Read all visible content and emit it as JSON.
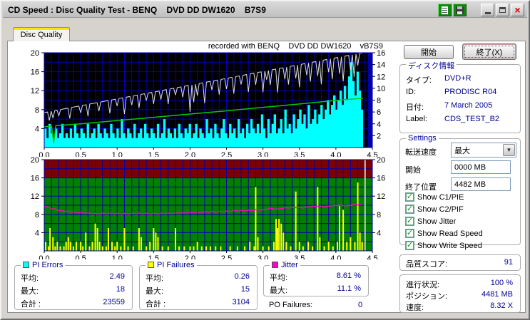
{
  "window": {
    "title": "CD Speed : Disc Quality Test - BENQ    DVD DD DW1620    B7S9"
  },
  "tab": {
    "label": "Disc Quality"
  },
  "chart_caption": "recorded with BENQ    DVD DD DW1620    vB7S9",
  "buttons": {
    "start": "開始",
    "exit": "終了(X)"
  },
  "disc_info": {
    "title": "ディスク情報",
    "rows": [
      {
        "label": "タイプ:",
        "value": "DVD+R"
      },
      {
        "label": "ID:",
        "value": "PRODISC R04"
      },
      {
        "label": "日付:",
        "value": "7 March 2005"
      },
      {
        "label": "Label:",
        "value": "CDS_TEST_B2"
      }
    ]
  },
  "settings": {
    "title": "Settings",
    "transfer_label": "転送速度",
    "transfer_value": "最大",
    "start_label": "開始",
    "start_value": "0000 MB",
    "end_label": "終了位置",
    "end_value": "4482 MB",
    "checkboxes": [
      {
        "label": "Show C1/PIE",
        "checked": true
      },
      {
        "label": "Show C2/PIF",
        "checked": true
      },
      {
        "label": "Show Jitter",
        "checked": true
      },
      {
        "label": "Show Read Speed",
        "checked": true
      },
      {
        "label": "Show Write Speed",
        "checked": true
      }
    ]
  },
  "quality": {
    "label": "品質スコア:",
    "value": "91"
  },
  "progress": {
    "rows": [
      {
        "label": "進行状況:",
        "value": "100 %"
      },
      {
        "label": "ポジション:",
        "value": "4481 MB"
      },
      {
        "label": "速度:",
        "value": "8.32 X"
      }
    ]
  },
  "stats": {
    "pi_errors": {
      "title": "PI Errors",
      "legend_color": "#00ffff",
      "rows": [
        {
          "label": "平均:",
          "value": "2.49"
        },
        {
          "label": "最大:",
          "value": "18"
        },
        {
          "label": "合計 :",
          "value": "23559"
        }
      ]
    },
    "pi_failures": {
      "title": "PI Failures",
      "legend_color": "#ffff00",
      "rows": [
        {
          "label": "平均:",
          "value": "0.26"
        },
        {
          "label": "最大:",
          "value": "15"
        },
        {
          "label": "合計 :",
          "value": "3104"
        }
      ]
    },
    "jitter": {
      "title": "Jitter",
      "legend_color": "#ff00cc",
      "rows": [
        {
          "label": "平均:",
          "value": "8.61 %"
        },
        {
          "label": "最大:",
          "value": "11.1 %"
        }
      ]
    },
    "po_failures": {
      "label": "PO Failures:",
      "value": "0"
    }
  },
  "chart_data": [
    {
      "type": "area",
      "title": "PI Errors with Read/Write Speed",
      "x_range": [
        0,
        4.5
      ],
      "x_ticks": [
        "0.0",
        "0.5",
        "1.0",
        "1.5",
        "2.0",
        "2.5",
        "3.0",
        "3.5",
        "4.0",
        "4.5"
      ],
      "left_axis": {
        "range": [
          0,
          20
        ],
        "ticks": [
          20,
          16,
          12,
          8,
          4
        ],
        "minor_step": 2
      },
      "right_axis": {
        "range": [
          0,
          16
        ],
        "ticks": [
          16,
          14,
          12,
          10,
          8,
          6,
          4,
          2
        ]
      },
      "bg": "#000000",
      "grid": "#0000b0",
      "data_end_x": 4.37,
      "pi_errors": {
        "name": "PI Errors",
        "color": "#00ffff",
        "axis": "left",
        "values": [
          4,
          2,
          5,
          3,
          2,
          4,
          2,
          3,
          5,
          2,
          3,
          2,
          4,
          2,
          5,
          3,
          2,
          4,
          3,
          2,
          5,
          2,
          3,
          4,
          2,
          5,
          3,
          2,
          4,
          3,
          2,
          5,
          3,
          2,
          4,
          2,
          6,
          3,
          2,
          4,
          3,
          2,
          5,
          2,
          3,
          4,
          2,
          5,
          3,
          2,
          4,
          3,
          2,
          5,
          2,
          3,
          6,
          2,
          4,
          3,
          2,
          4,
          2,
          5,
          3,
          2,
          4,
          3,
          5,
          2,
          3,
          5,
          2,
          4,
          3,
          2,
          6,
          3,
          4,
          2,
          5,
          3,
          2,
          4,
          6,
          3,
          2,
          5,
          3,
          4,
          2,
          6,
          3,
          4,
          2,
          5,
          3,
          6,
          4,
          3,
          5,
          3,
          7,
          4,
          2,
          6,
          3,
          5,
          7,
          3,
          4,
          6,
          3,
          8,
          4,
          5,
          3,
          7,
          4,
          6,
          8,
          5,
          7,
          4,
          9,
          5,
          6,
          8,
          5,
          7,
          9,
          6,
          8,
          10,
          7,
          9,
          11,
          8,
          10,
          12,
          9,
          13,
          10,
          15,
          18,
          14,
          11,
          16,
          12,
          8
        ]
      },
      "write_speed": {
        "name": "Write Speed",
        "color": "#dcdcdc",
        "axis": "right",
        "start": 5.9,
        "end": 16.0,
        "dips": [
          [
            0.07,
            1.5
          ],
          [
            0.12,
            1.2
          ],
          [
            0.2,
            1.0
          ],
          [
            0.35,
            1.8
          ],
          [
            0.5,
            1.2
          ],
          [
            0.6,
            2.0
          ],
          [
            0.75,
            1.5
          ],
          [
            0.9,
            2.2
          ],
          [
            1.0,
            1.2
          ],
          [
            1.1,
            2.8
          ],
          [
            1.2,
            1.5
          ],
          [
            1.3,
            2.2
          ],
          [
            1.4,
            1.2
          ],
          [
            1.5,
            2.0
          ],
          [
            1.6,
            1.5
          ],
          [
            1.7,
            2.5
          ],
          [
            1.8,
            1.2
          ],
          [
            1.9,
            1.8
          ],
          [
            2.0,
            4.5
          ],
          [
            2.05,
            3.0
          ],
          [
            2.1,
            2.0
          ],
          [
            2.2,
            3.5
          ],
          [
            2.3,
            1.5
          ],
          [
            2.4,
            2.5
          ],
          [
            2.5,
            1.8
          ],
          [
            2.6,
            2.8
          ],
          [
            2.7,
            1.5
          ],
          [
            2.8,
            3.0
          ],
          [
            2.9,
            2.0
          ],
          [
            3.0,
            3.5
          ],
          [
            3.05,
            1.5
          ],
          [
            3.1,
            2.5
          ],
          [
            3.2,
            4.0
          ],
          [
            3.3,
            2.0
          ],
          [
            3.35,
            3.0
          ],
          [
            3.45,
            2.2
          ],
          [
            3.5,
            3.8
          ],
          [
            3.6,
            2.0
          ],
          [
            3.65,
            3.2
          ],
          [
            3.75,
            2.5
          ],
          [
            3.8,
            4.0
          ],
          [
            3.9,
            2.2
          ],
          [
            3.95,
            3.5
          ],
          [
            4.05,
            2.8
          ],
          [
            4.1,
            4.2
          ],
          [
            4.2,
            2.5
          ],
          [
            4.25,
            3.8
          ],
          [
            4.3,
            2.0
          ]
        ]
      },
      "read_speed": {
        "name": "Read Speed",
        "color": "#00cc00",
        "axis": "right",
        "points": [
          [
            0,
            3.5
          ],
          [
            0.1,
            3.62
          ],
          [
            0.13,
            0.8
          ],
          [
            0.16,
            3.7
          ],
          [
            0.5,
            4.0
          ],
          [
            1.0,
            4.55
          ],
          [
            1.5,
            5.1
          ],
          [
            2.0,
            5.65
          ],
          [
            2.5,
            6.2
          ],
          [
            3.0,
            6.78
          ],
          [
            3.5,
            7.35
          ],
          [
            4.0,
            7.95
          ],
          [
            4.37,
            8.32
          ]
        ]
      }
    },
    {
      "type": "bars",
      "title": "PI Failures with Jitter",
      "x_range": [
        0,
        4.5
      ],
      "x_ticks": [
        "0.0",
        "0.5",
        "1.0",
        "1.5",
        "2.0",
        "2.5",
        "3.0",
        "3.5",
        "4.0",
        "4.5"
      ],
      "left_axis": {
        "range": [
          0,
          20
        ],
        "ticks": [
          20,
          16,
          12,
          8,
          4
        ],
        "minor_step": 2
      },
      "right_axis": {
        "range": [
          0,
          20
        ],
        "ticks": [
          20,
          16,
          12,
          8,
          4
        ]
      },
      "bg_good": "#008000",
      "bg_bad": "#7c0000",
      "bad_threshold": 16,
      "grid": "#0000b0",
      "end_marker_x": 4.4,
      "end_marker_color": "#c8c8c8",
      "pi_failures": {
        "name": "PI Failures",
        "color": "#ffff00",
        "spikes": [
          [
            0.02,
            2
          ],
          [
            0.06,
            1
          ],
          [
            0.08,
            5
          ],
          [
            0.12,
            3
          ],
          [
            0.15,
            1
          ],
          [
            0.18,
            2
          ],
          [
            0.22,
            1
          ],
          [
            0.27,
            1
          ],
          [
            0.3,
            2
          ],
          [
            0.33,
            3
          ],
          [
            0.36,
            2
          ],
          [
            0.4,
            1
          ],
          [
            0.44,
            2
          ],
          [
            0.5,
            2
          ],
          [
            0.53,
            1
          ],
          [
            0.57,
            4
          ],
          [
            0.62,
            1
          ],
          [
            0.66,
            2
          ],
          [
            0.7,
            6
          ],
          [
            0.73,
            5
          ],
          [
            0.76,
            2
          ],
          [
            0.8,
            1
          ],
          [
            0.85,
            1
          ],
          [
            0.88,
            5
          ],
          [
            0.93,
            2
          ],
          [
            0.97,
            1
          ],
          [
            1.0,
            2
          ],
          [
            1.05,
            1
          ],
          [
            1.1,
            5
          ],
          [
            1.15,
            1
          ],
          [
            1.22,
            1
          ],
          [
            1.3,
            5
          ],
          [
            1.33,
            3
          ],
          [
            1.4,
            1
          ],
          [
            1.45,
            2
          ],
          [
            1.5,
            5
          ],
          [
            1.53,
            4
          ],
          [
            1.56,
            3
          ],
          [
            1.62,
            1
          ],
          [
            1.7,
            1
          ],
          [
            1.8,
            5
          ],
          [
            1.85,
            1
          ],
          [
            1.92,
            1
          ],
          [
            2.0,
            1
          ],
          [
            2.05,
            1
          ],
          [
            2.1,
            2
          ],
          [
            2.16,
            1
          ],
          [
            2.22,
            1
          ],
          [
            2.28,
            1
          ],
          [
            2.35,
            1
          ],
          [
            2.42,
            1
          ],
          [
            2.55,
            1
          ],
          [
            2.65,
            1
          ],
          [
            2.75,
            1
          ],
          [
            2.82,
            2
          ],
          [
            2.88,
            1
          ],
          [
            2.9,
            14
          ],
          [
            2.93,
            3
          ],
          [
            3.0,
            1
          ],
          [
            3.08,
            1
          ],
          [
            3.15,
            2
          ],
          [
            3.18,
            7
          ],
          [
            3.2,
            5
          ],
          [
            3.22,
            7
          ],
          [
            3.25,
            6
          ],
          [
            3.28,
            4
          ],
          [
            3.32,
            2
          ],
          [
            3.38,
            1
          ],
          [
            3.45,
            13
          ],
          [
            3.5,
            2
          ],
          [
            3.55,
            1
          ],
          [
            3.62,
            2
          ],
          [
            3.68,
            1
          ],
          [
            3.75,
            14
          ],
          [
            3.78,
            3
          ],
          [
            3.84,
            1
          ],
          [
            3.9,
            2
          ],
          [
            3.96,
            1
          ],
          [
            4.02,
            2
          ],
          [
            4.05,
            10
          ],
          [
            4.1,
            9
          ],
          [
            4.15,
            2
          ],
          [
            4.2,
            3
          ],
          [
            4.26,
            2
          ],
          [
            4.3,
            15
          ],
          [
            4.33,
            4
          ],
          [
            4.36,
            2
          ]
        ]
      },
      "jitter": {
        "name": "Jitter",
        "color": "#ff00cc",
        "points": [
          [
            0,
            9.8
          ],
          [
            0.1,
            9.3
          ],
          [
            0.2,
            8.9
          ],
          [
            0.35,
            8.55
          ],
          [
            0.5,
            8.35
          ],
          [
            0.7,
            8.15
          ],
          [
            0.9,
            8.2
          ],
          [
            1.1,
            8.15
          ],
          [
            1.3,
            8.2
          ],
          [
            1.5,
            8.15
          ],
          [
            1.7,
            8.2
          ],
          [
            1.9,
            8.3
          ],
          [
            2.0,
            8.4
          ],
          [
            2.2,
            8.5
          ],
          [
            2.4,
            8.6
          ],
          [
            2.6,
            8.75
          ],
          [
            2.8,
            8.85
          ],
          [
            3.0,
            9.0
          ],
          [
            3.1,
            9.3
          ],
          [
            3.2,
            9.15
          ],
          [
            3.3,
            9.4
          ],
          [
            3.45,
            9.55
          ],
          [
            3.55,
            9.45
          ],
          [
            3.65,
            9.7
          ],
          [
            3.75,
            9.8
          ],
          [
            3.85,
            9.7
          ],
          [
            3.95,
            9.9
          ],
          [
            4.05,
            10.0
          ],
          [
            4.15,
            9.9
          ],
          [
            4.25,
            10.1
          ],
          [
            4.36,
            10.2
          ]
        ]
      }
    }
  ]
}
